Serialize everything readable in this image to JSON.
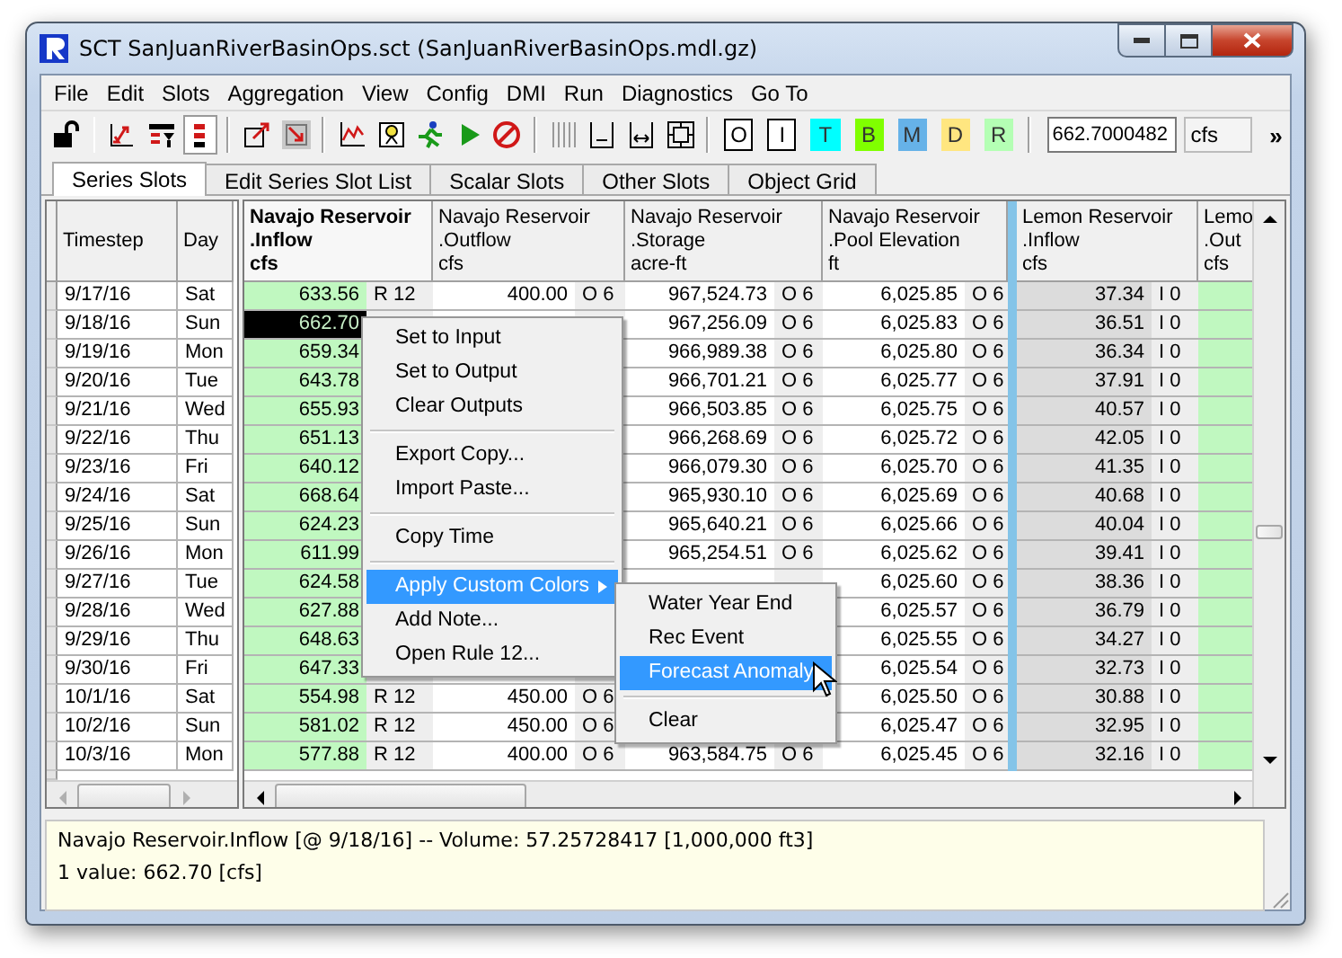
{
  "window": {
    "title": "SCT SanJuanRiverBasinOps.sct (SanJuanRiverBasinOps.mdl.gz)"
  },
  "menu_bar": [
    "File",
    "Edit",
    "Slots",
    "Aggregation",
    "View",
    "Config",
    "DMI",
    "Run",
    "Diagnostics",
    "Go To"
  ],
  "toolbar": {
    "groups": [
      [
        {
          "kind": "lock",
          "pressed": false
        }
      ],
      [
        {
          "kind": "swap",
          "pressed": false
        },
        {
          "kind": "filter",
          "pressed": false
        },
        {
          "kind": "bars",
          "pressed": true
        }
      ],
      [
        {
          "kind": "box-out",
          "pressed": false
        },
        {
          "kind": "box-in",
          "pressed": false
        }
      ],
      [
        {
          "kind": "chart",
          "pressed": false
        },
        {
          "kind": "gauge",
          "pressed": false
        },
        {
          "kind": "runner",
          "pressed": false
        },
        {
          "kind": "play",
          "pressed": false
        },
        {
          "kind": "stop",
          "pressed": false
        }
      ],
      [
        {
          "kind": "columns",
          "pressed": false
        },
        {
          "kind": "bracket-left",
          "pressed": false
        },
        {
          "kind": "bracket-both",
          "pressed": false
        },
        {
          "kind": "bracket-box",
          "pressed": false
        }
      ]
    ],
    "flag_buttons": [
      {
        "label": "O",
        "color": "#ffffff"
      },
      {
        "label": "I",
        "color": "#ffffff"
      },
      {
        "label": "T",
        "color": "#00ffff"
      },
      {
        "label": "B",
        "color": "#80ff00"
      },
      {
        "label": "M",
        "color": "#66b2e8"
      },
      {
        "label": "D",
        "color": "#ffe680"
      },
      {
        "label": "R",
        "color": "#b4ffb4"
      }
    ],
    "value": "662.7000482",
    "unit": "cfs",
    "overflow": "»"
  },
  "tabs": [
    {
      "label": "Series Slots",
      "selected": true
    },
    {
      "label": "Edit Series Slot List",
      "selected": false
    },
    {
      "label": "Scalar Slots",
      "selected": false
    },
    {
      "label": "Other Slots",
      "selected": false
    },
    {
      "label": "Object Grid",
      "selected": false
    }
  ],
  "table": {
    "fixed_columns": [
      "Timestep",
      "Day"
    ],
    "columns": [
      {
        "name": "Navajo Reservoir",
        "slot": ".Inflow",
        "unit": "cfs",
        "kind": "rule",
        "selected": true
      },
      {
        "name": "Navajo Reservoir",
        "slot": ".Outflow",
        "unit": "cfs",
        "kind": "output",
        "selected": false
      },
      {
        "name": "Navajo Reservoir",
        "slot": ".Storage",
        "unit": "acre-ft",
        "kind": "output",
        "selected": false
      },
      {
        "name": "Navajo Reservoir",
        "slot": ".Pool Elevation",
        "unit": "ft",
        "kind": "output",
        "selected": false
      },
      {
        "name": "Lemon Reservoir",
        "slot": ".Inflow",
        "unit": "cfs",
        "kind": "input",
        "selected": false
      },
      {
        "name": "Lemo",
        "slot": ".Out",
        "unit": "cfs",
        "kind": "rule",
        "selected": false
      }
    ],
    "rows": [
      {
        "timestep": "9/17/16",
        "day": "Sat",
        "selected": false,
        "cells": [
          {
            "value": "633.56",
            "flag": "R 12"
          },
          {
            "value": "400.00",
            "flag": "O 6"
          },
          {
            "value": "967,524.73",
            "flag": "O 6"
          },
          {
            "value": "6,025.85",
            "flag": "O 6"
          },
          {
            "value": "37.34",
            "flag": "I 0"
          }
        ]
      },
      {
        "timestep": "9/18/16",
        "day": "Sun",
        "selected": true,
        "cells": [
          {
            "value": "662.70"
          },
          {},
          {
            "value": "967,256.09",
            "flag": "O 6"
          },
          {
            "value": "6,025.83",
            "flag": "O 6"
          },
          {
            "value": "36.51",
            "flag": "I 0"
          }
        ]
      },
      {
        "timestep": "9/19/16",
        "day": "Mon",
        "selected": false,
        "cells": [
          {
            "value": "659.34"
          },
          {},
          {
            "value": "966,989.38",
            "flag": "O 6"
          },
          {
            "value": "6,025.80",
            "flag": "O 6"
          },
          {
            "value": "36.34",
            "flag": "I 0"
          }
        ]
      },
      {
        "timestep": "9/20/16",
        "day": "Tue",
        "selected": false,
        "cells": [
          {
            "value": "643.78"
          },
          {},
          {
            "value": "966,701.21",
            "flag": "O 6"
          },
          {
            "value": "6,025.77",
            "flag": "O 6"
          },
          {
            "value": "37.91",
            "flag": "I 0"
          }
        ]
      },
      {
        "timestep": "9/21/16",
        "day": "Wed",
        "selected": false,
        "cells": [
          {
            "value": "655.93"
          },
          {},
          {
            "value": "966,503.85",
            "flag": "O 6"
          },
          {
            "value": "6,025.75",
            "flag": "O 6"
          },
          {
            "value": "40.57",
            "flag": "I 0"
          }
        ]
      },
      {
        "timestep": "9/22/16",
        "day": "Thu",
        "selected": false,
        "cells": [
          {
            "value": "651.13"
          },
          {},
          {
            "value": "966,268.69",
            "flag": "O 6"
          },
          {
            "value": "6,025.72",
            "flag": "O 6"
          },
          {
            "value": "42.05",
            "flag": "I 0"
          }
        ]
      },
      {
        "timestep": "9/23/16",
        "day": "Fri",
        "selected": false,
        "cells": [
          {
            "value": "640.12"
          },
          {},
          {
            "value": "966,079.30",
            "flag": "O 6"
          },
          {
            "value": "6,025.70",
            "flag": "O 6"
          },
          {
            "value": "41.35",
            "flag": "I 0"
          }
        ]
      },
      {
        "timestep": "9/24/16",
        "day": "Sat",
        "selected": false,
        "cells": [
          {
            "value": "668.64"
          },
          {},
          {
            "value": "965,930.10",
            "flag": "O 6"
          },
          {
            "value": "6,025.69",
            "flag": "O 6"
          },
          {
            "value": "40.68",
            "flag": "I 0"
          }
        ]
      },
      {
        "timestep": "9/25/16",
        "day": "Sun",
        "selected": false,
        "cells": [
          {
            "value": "624.23"
          },
          {},
          {
            "value": "965,640.21",
            "flag": "O 6"
          },
          {
            "value": "6,025.66",
            "flag": "O 6"
          },
          {
            "value": "40.04",
            "flag": "I 0"
          }
        ]
      },
      {
        "timestep": "9/26/16",
        "day": "Mon",
        "selected": false,
        "cells": [
          {
            "value": "611.99"
          },
          {},
          {
            "value": "965,254.51",
            "flag": "O 6"
          },
          {
            "value": "6,025.62",
            "flag": "O 6"
          },
          {
            "value": "39.41",
            "flag": "I 0"
          }
        ]
      },
      {
        "timestep": "9/27/16",
        "day": "Tue",
        "selected": false,
        "cells": [
          {
            "value": "624.58"
          },
          {},
          {},
          {
            "value": "6,025.60",
            "flag": "O 6"
          },
          {
            "value": "38.36",
            "flag": "I 0"
          }
        ]
      },
      {
        "timestep": "9/28/16",
        "day": "Wed",
        "selected": false,
        "cells": [
          {
            "value": "627.88"
          },
          {},
          {},
          {
            "value": "6,025.57",
            "flag": "O 6"
          },
          {
            "value": "36.79",
            "flag": "I 0"
          }
        ]
      },
      {
        "timestep": "9/29/16",
        "day": "Thu",
        "selected": false,
        "cells": [
          {
            "value": "648.63"
          },
          {},
          {},
          {
            "value": "6,025.55",
            "flag": "O 6"
          },
          {
            "value": "34.27",
            "flag": "I 0"
          }
        ]
      },
      {
        "timestep": "9/30/16",
        "day": "Fri",
        "selected": false,
        "cells": [
          {
            "value": "647.33"
          },
          {},
          {},
          {
            "value": "6,025.54",
            "flag": "O 6"
          },
          {
            "value": "32.73",
            "flag": "I 0"
          }
        ]
      },
      {
        "timestep": "10/1/16",
        "day": "Sat",
        "selected": false,
        "cells": [
          {
            "value": "554.98",
            "flag": "R 12"
          },
          {
            "value": "450.00",
            "flag": "O 6"
          },
          {},
          {
            "value": "6,025.50",
            "flag": "O 6"
          },
          {
            "value": "30.88",
            "flag": "I 0"
          }
        ]
      },
      {
        "timestep": "10/2/16",
        "day": "Sun",
        "selected": false,
        "cells": [
          {
            "value": "581.02",
            "flag": "R 12"
          },
          {
            "value": "450.00",
            "flag": "O 6"
          },
          {},
          {
            "value": "6,025.47",
            "flag": "O 6"
          },
          {
            "value": "32.95",
            "flag": "I 0"
          }
        ]
      },
      {
        "timestep": "10/3/16",
        "day": "Mon",
        "selected": false,
        "cells": [
          {
            "value": "577.88",
            "flag": "R 12"
          },
          {
            "value": "400.00",
            "flag": "O 6"
          },
          {
            "value": "963,584.75",
            "flag": "O 6"
          },
          {
            "value": "6,025.45",
            "flag": "O 6"
          },
          {
            "value": "32.16",
            "flag": "I 0"
          }
        ]
      }
    ]
  },
  "context_menu": {
    "items": [
      {
        "kind": "item",
        "label": "Set to Input",
        "selected": false
      },
      {
        "kind": "item",
        "label": "Set to Output",
        "selected": false
      },
      {
        "kind": "item",
        "label": "Clear Outputs",
        "selected": false
      },
      {
        "kind": "separator"
      },
      {
        "kind": "item",
        "label": "Export Copy...",
        "selected": false
      },
      {
        "kind": "item",
        "label": "Import Paste...",
        "selected": false
      },
      {
        "kind": "separator"
      },
      {
        "kind": "item",
        "label": "Copy Time",
        "selected": false
      },
      {
        "kind": "separator"
      },
      {
        "kind": "submenu",
        "label": "Apply Custom Colors",
        "selected": true
      },
      {
        "kind": "item",
        "label": "Add Note...",
        "selected": false
      },
      {
        "kind": "item",
        "label": "Open Rule 12...",
        "selected": false
      }
    ]
  },
  "submenu": {
    "items": [
      {
        "kind": "item",
        "label": "Water Year End",
        "selected": false
      },
      {
        "kind": "item",
        "label": "Rec Event",
        "selected": false
      },
      {
        "kind": "item",
        "label": "Forecast Anomaly",
        "selected": true
      },
      {
        "kind": "separator"
      },
      {
        "kind": "item",
        "label": "Clear",
        "selected": false
      }
    ]
  },
  "status": [
    "Navajo Reservoir.Inflow [@ 9/18/16] -- Volume: 57.25728417 [1,000,000 ft3]",
    "1 value:  662.70 [cfs]"
  ]
}
